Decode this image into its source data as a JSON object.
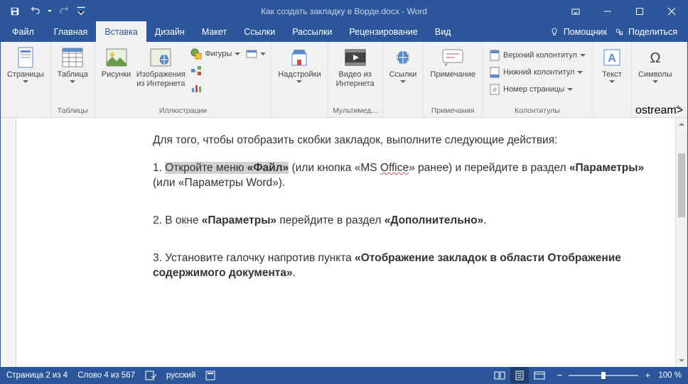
{
  "title": "Как создать закладку в Ворде.docx  -  Word",
  "qat": {
    "save": "save",
    "undo": "undo",
    "redo": "redo",
    "customize": "customize"
  },
  "tabs": {
    "file": "Файл",
    "home": "Главная",
    "insert": "Вставка",
    "design": "Дизайн",
    "layout": "Макет",
    "references": "Ссылки",
    "mailings": "Рассылки",
    "review": "Рецензирование",
    "view": "Вид"
  },
  "helper_placeholder": "Помощник",
  "share": "Поделиться",
  "ribbon": {
    "pages": {
      "label": "Страницы",
      "group": ""
    },
    "tables": {
      "label": "Таблица",
      "group": "Таблицы"
    },
    "illustrations": {
      "pictures": "Рисунки",
      "online_pictures": "Изображения из Интернета",
      "shape": "Фигуры",
      "icons": "",
      "smartart": "",
      "chart": "",
      "screenshot": "",
      "group": "Иллюстрации"
    },
    "addins": {
      "label": "Надстройки",
      "group": ""
    },
    "media": {
      "video": "Видео из Интернета",
      "group": "Мультимед..."
    },
    "links": {
      "label": "Ссылки",
      "group": ""
    },
    "comments": {
      "label": "Примечание",
      "group": "Примечания"
    },
    "headerfooter": {
      "header": "Верхний колонтитул",
      "footer": "Нижний колонтитул",
      "page_number": "Номер страницы",
      "group": "Колонтитулы"
    },
    "text": {
      "label": "Текст",
      "group": ""
    },
    "symbols": {
      "label": "Символы",
      "group": ""
    }
  },
  "document": {
    "intro": "Для того, чтобы отобразить скобки закладок, выполните следующие действия:",
    "s1_pre": "1. ",
    "s1_hl_a": "Откройте меню ",
    "s1_hl_b": "«Файл»",
    "s1_mid_a": " (или кнопка «MS ",
    "s1_office": "Office",
    "s1_mid_b": "» ранее) и перейдите в раздел ",
    "s1_param": "«Параметры»",
    "s1_tail": " (или «Параметры Word»).",
    "s2_a": "2. В окне ",
    "s2_b": "«Параметры»",
    "s2_c": " перейдите в раздел ",
    "s2_d": "«Дополнительно»",
    "s2_e": ".",
    "s3_a": "3. Установите галочку напротив пункта ",
    "s3_b": "«Отображение закладок в области Отображение содержимого документа»",
    "s3_c": "."
  },
  "status": {
    "page": "Страница 2 из 4",
    "words": "Слово 4 из 567",
    "lang": "русский",
    "zoom": "100 %"
  }
}
